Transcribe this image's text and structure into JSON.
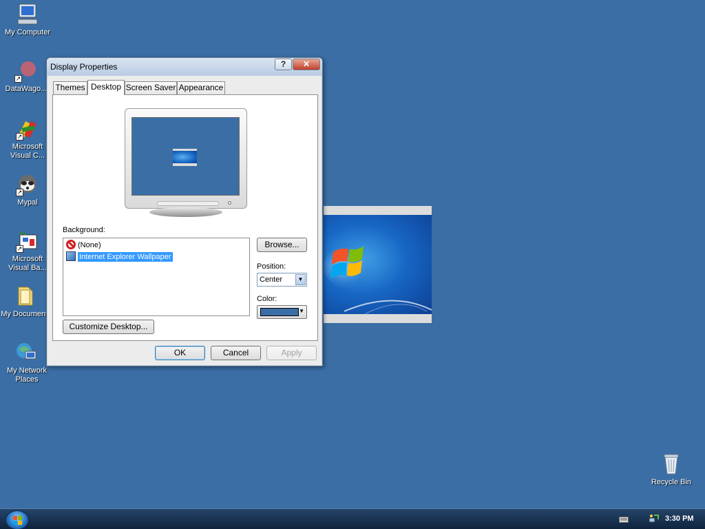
{
  "desktop": {
    "icons": [
      {
        "label": "My Computer"
      },
      {
        "label": "DataWago..."
      },
      {
        "label": "Microsoft Visual C..."
      },
      {
        "label": "Mypal"
      },
      {
        "label": "Microsoft Visual Ba..."
      },
      {
        "label": "My Documents"
      },
      {
        "label": "My Network Places"
      },
      {
        "label": "Recycle Bin"
      }
    ],
    "background_color": "#3a6ea5"
  },
  "dialog": {
    "title": "Display Properties",
    "help_button": "?",
    "close_button": "✕",
    "tabs": [
      {
        "label": "Themes",
        "active": false
      },
      {
        "label": "Desktop",
        "active": true
      },
      {
        "label": "Screen Saver",
        "active": false
      },
      {
        "label": "Appearance",
        "active": false
      }
    ],
    "background_label": "Background:",
    "background_items": [
      {
        "label": "(None)",
        "icon": "none-icon",
        "selected": false
      },
      {
        "label": "Internet Explorer Wallpaper",
        "icon": "wallpaper-icon",
        "selected": true
      }
    ],
    "browse_button": "Browse...",
    "position_label": "Position:",
    "position_value": "Center",
    "color_label": "Color:",
    "color_value": "#3a6ea5",
    "customize_button": "Customize Desktop...",
    "ok_button": "OK",
    "cancel_button": "Cancel",
    "apply_button": "Apply"
  },
  "taskbar": {
    "clock": "3:30 PM",
    "tray_icons": [
      "keyboard-icon",
      "network-icon"
    ]
  }
}
